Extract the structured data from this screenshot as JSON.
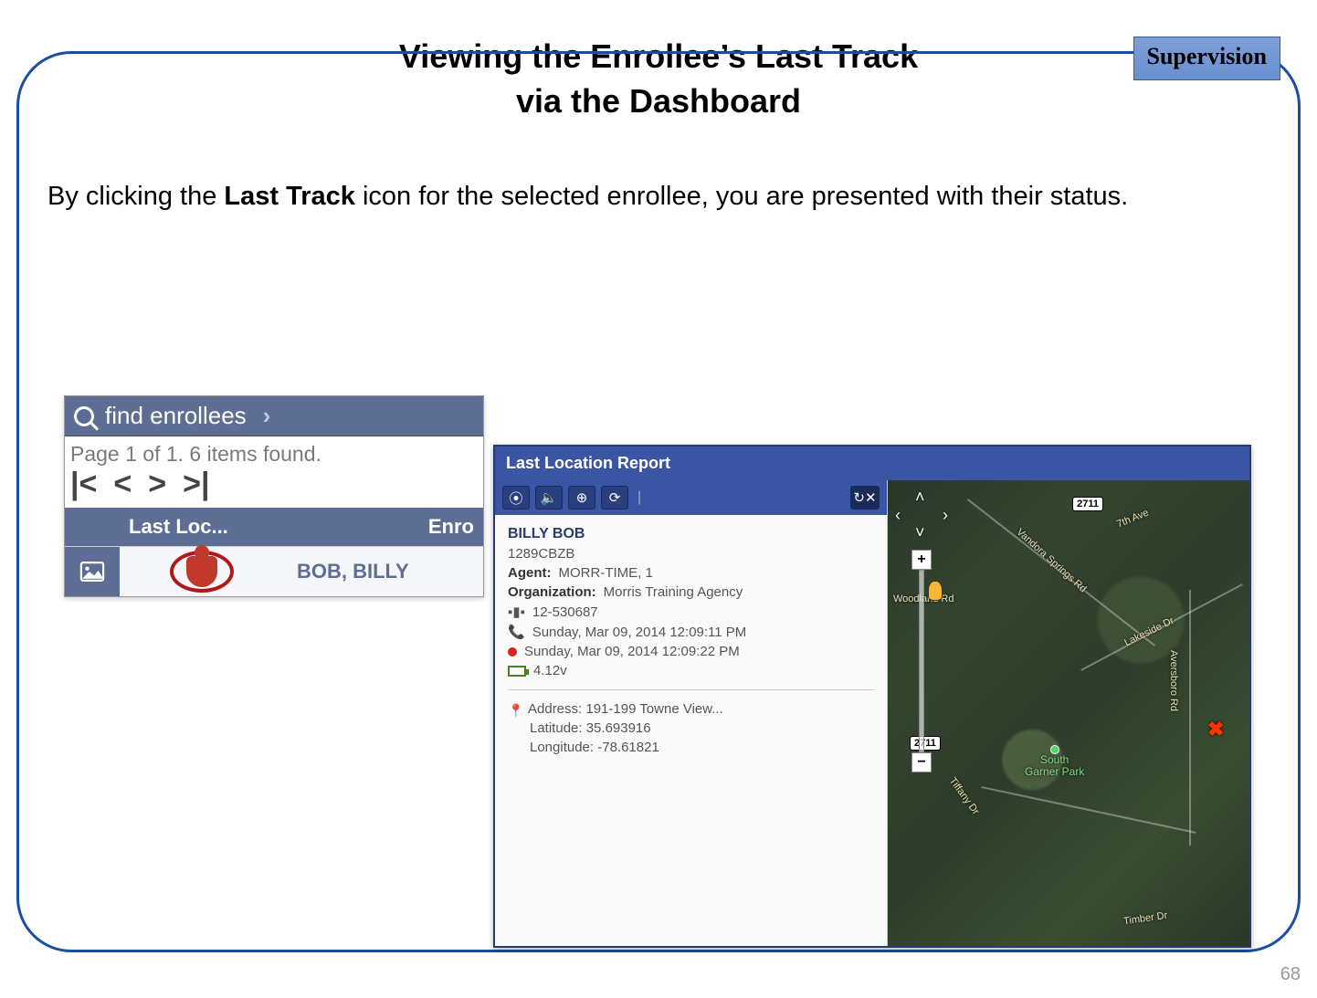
{
  "badge": "Supervision",
  "title_line1": "Viewing the Enrollee’s Last Track",
  "title_line2": "via the Dashboard",
  "body_pre": "By clicking the ",
  "body_bold": "Last Track",
  "body_post": " icon for the selected enrollee, you are presented with their status.",
  "page_number": "68",
  "dashboard": {
    "search_placeholder": "find enrollees",
    "results_text": "Page 1 of 1. 6 items found.",
    "nav_first": "|<",
    "nav_prev": "<",
    "nav_next": ">",
    "nav_last": ">|",
    "col_lastloc": "Last Loc...",
    "col_enrollee": "Enro",
    "row1_name": "BOB, BILLY"
  },
  "report": {
    "header": "Last Location Report",
    "toolbar": {
      "b1": "⦿",
      "b2": "🔈",
      "b3": "⊕",
      "b4": "⟳",
      "refresh": "↻✕"
    },
    "name": "BILLY BOB",
    "device_id": "1289CBZB",
    "agent_label": "Agent:",
    "agent": "MORR-TIME, 1",
    "org_label": "Organization:",
    "org": "Morris Training Agency",
    "case_no": "12-530687",
    "call_time": "Sunday, Mar 09, 2014 12:09:11 PM",
    "gps_time": "Sunday, Mar 09, 2014 12:09:22 PM",
    "battery": "4.12v",
    "address": "Address: 191-199 Towne View...",
    "latitude": "Latitude: 35.693916",
    "longitude": "Longitude: -78.61821"
  },
  "map": {
    "shield1": "2711",
    "shield2": "2711",
    "road1": "7th Ave",
    "road2": "Vandora Springs Rd",
    "road3": "Lakeside Dr",
    "road4": "Aversboro Rd",
    "road5": "Timber Dr",
    "road6": "Woodland Rd",
    "road7": "Tiffany Dr",
    "park": "South\nGarner Park",
    "zoom_in": "+",
    "zoom_out": "−"
  }
}
